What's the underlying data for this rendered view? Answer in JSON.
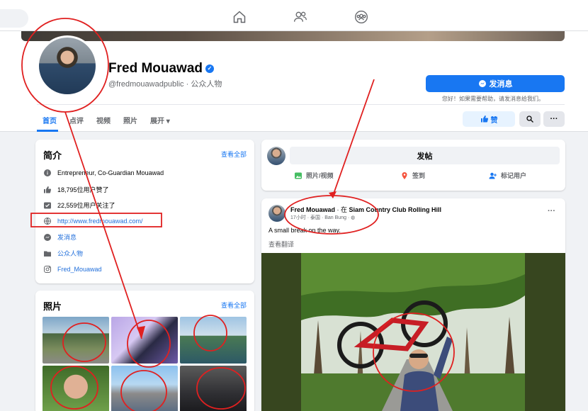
{
  "topnav": {
    "icons": [
      "home-icon",
      "friends-icon",
      "groups-icon"
    ]
  },
  "profile": {
    "name": "Fred Mouawad",
    "verified_mark": "✓",
    "subtitle": "@fredmouawadpublic · 公众人物",
    "message_button": "发消息",
    "message_hint": "您好！如果需要帮助，请发消息给我们。",
    "like_button": "赞",
    "more_button": "···",
    "tabs": [
      "首页",
      "点评",
      "视频",
      "照片",
      "展开 ▾"
    ]
  },
  "intro": {
    "title": "简介",
    "see_all": "查看全部",
    "items": [
      {
        "icon": "info-icon",
        "text": "Entrepreneur, Co-Guardian Mouawad"
      },
      {
        "icon": "thumbs-up-icon",
        "text": "18,795位用户赞了"
      },
      {
        "icon": "follow-check-icon",
        "text": "22,559位用户关注了"
      },
      {
        "icon": "globe-icon",
        "text": "http://www.fredmouawad.com/"
      },
      {
        "icon": "messenger-icon",
        "text": "发消息"
      },
      {
        "icon": "category-folder-icon",
        "text": "公众人物"
      },
      {
        "icon": "instagram-icon",
        "text": "Fred_Mouawad"
      }
    ]
  },
  "photos": {
    "title": "照片",
    "see_all": "查看全部"
  },
  "composer": {
    "post_button": "发帖",
    "actions": [
      {
        "icon": "photo-video-icon",
        "label": "照片/视频"
      },
      {
        "icon": "check-in-icon",
        "label": "签到"
      },
      {
        "icon": "tag-people-icon",
        "label": "标记用户"
      }
    ]
  },
  "post": {
    "author": "Fred Mouawad",
    "location_prefix": " · 在 ",
    "location": "Siam Country Club Rolling Hill",
    "meta": "17小时 · 泰国 · Ban Bung · ",
    "text": "A small break on the way.",
    "translate": "查看翻译",
    "more": "···"
  },
  "colors": {
    "accent": "#1877f2",
    "annotation": "#e02020",
    "page_bg": "#f0f2f5"
  }
}
